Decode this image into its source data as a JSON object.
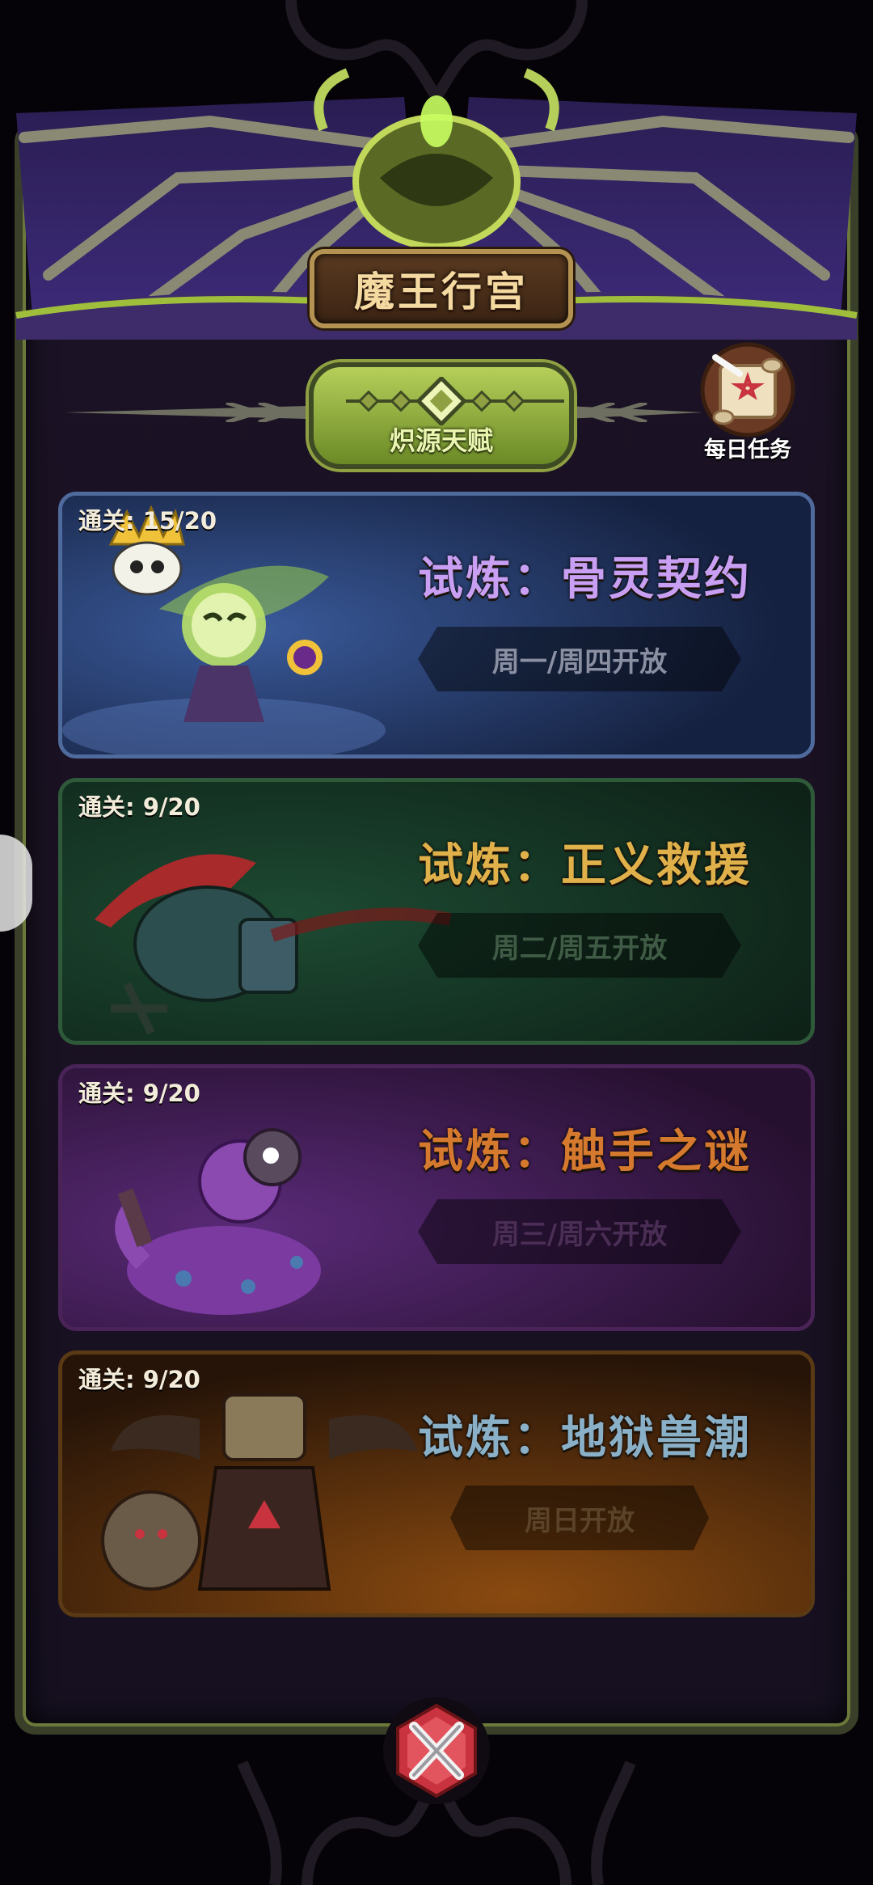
{
  "header": {
    "title": "魔王行宫",
    "talent_label": "炽源天赋",
    "daily_task_label": "每日任务"
  },
  "trials": [
    {
      "progress": "通关: 15/20",
      "name": "试炼：骨灵契约",
      "schedule": "周一/周四开放",
      "name_color": "#c89ff2",
      "schedule_color": "#8b8fa2",
      "theme": "bone"
    },
    {
      "progress": "通关: 9/20",
      "name": "试炼：正义救援",
      "schedule": "周二/周五开放",
      "name_color": "#e0b04a",
      "schedule_color": "#3f5b45",
      "theme": "justice"
    },
    {
      "progress": "通关: 9/20",
      "name": "试炼：触手之谜",
      "schedule": "周三/周六开放",
      "name_color": "#d5792e",
      "schedule_color": "#4b2e55",
      "theme": "tentacle"
    },
    {
      "progress": "通关: 9/20",
      "name": "试炼：地狱兽潮",
      "schedule": "周日开放",
      "name_color": "#8ab0c8",
      "schedule_color": "#5a4328",
      "theme": "hell"
    }
  ],
  "colors": {
    "accent_green": "#9fbe3c",
    "title_gold": "#f4d9a0",
    "close_red": "#c8333f"
  }
}
